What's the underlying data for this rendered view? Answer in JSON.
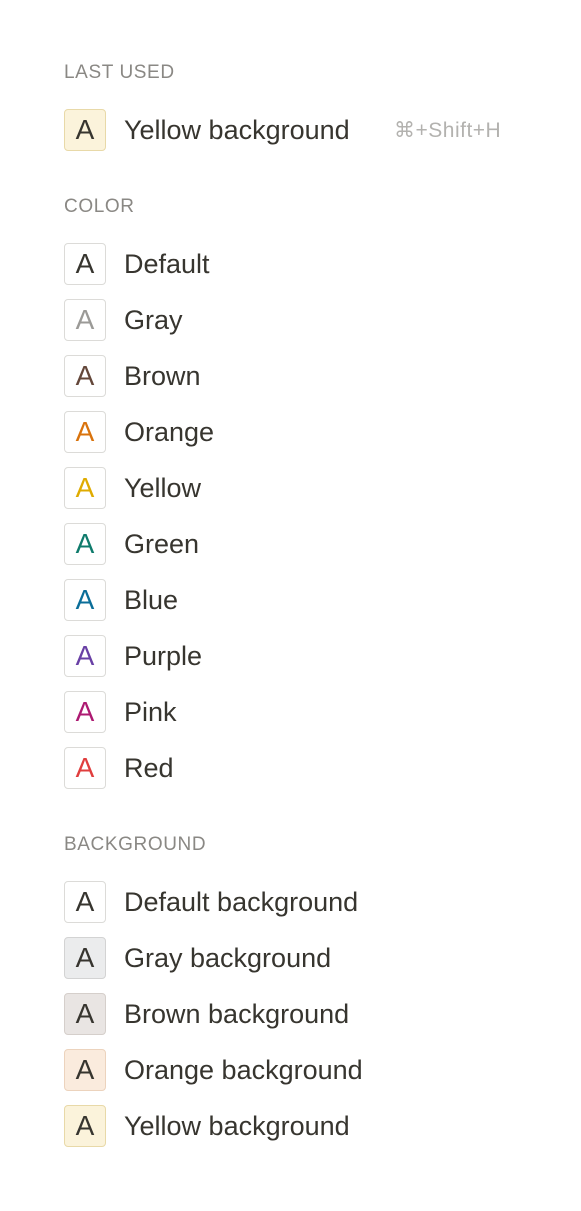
{
  "sections": {
    "last_used": {
      "title": "LAST USED",
      "items": [
        {
          "glyph": "A",
          "label": "Yellow background",
          "shortcut": "⌘+Shift+H",
          "text_color": "#37352f",
          "bg_color": "#fbf3db",
          "border_color": "#e8d9a8"
        }
      ]
    },
    "color": {
      "title": "COLOR",
      "items": [
        {
          "glyph": "A",
          "label": "Default",
          "text_color": "#37352f",
          "bg_color": "#ffffff"
        },
        {
          "glyph": "A",
          "label": "Gray",
          "text_color": "#9b9a97",
          "bg_color": "#ffffff"
        },
        {
          "glyph": "A",
          "label": "Brown",
          "text_color": "#64473a",
          "bg_color": "#ffffff"
        },
        {
          "glyph": "A",
          "label": "Orange",
          "text_color": "#d9730d",
          "bg_color": "#ffffff"
        },
        {
          "glyph": "A",
          "label": "Yellow",
          "text_color": "#dfab01",
          "bg_color": "#ffffff"
        },
        {
          "glyph": "A",
          "label": "Green",
          "text_color": "#0f7b6c",
          "bg_color": "#ffffff"
        },
        {
          "glyph": "A",
          "label": "Blue",
          "text_color": "#0b6e99",
          "bg_color": "#ffffff"
        },
        {
          "glyph": "A",
          "label": "Purple",
          "text_color": "#6940a5",
          "bg_color": "#ffffff"
        },
        {
          "glyph": "A",
          "label": "Pink",
          "text_color": "#ad1a72",
          "bg_color": "#ffffff"
        },
        {
          "glyph": "A",
          "label": "Red",
          "text_color": "#e03e3e",
          "bg_color": "#ffffff"
        }
      ]
    },
    "background": {
      "title": "BACKGROUND",
      "items": [
        {
          "glyph": "A",
          "label": "Default background",
          "text_color": "#37352f",
          "bg_color": "#ffffff",
          "border_color": "#dcdbd8"
        },
        {
          "glyph": "A",
          "label": "Gray background",
          "text_color": "#37352f",
          "bg_color": "#ebeced",
          "border_color": "#d3d3d3"
        },
        {
          "glyph": "A",
          "label": "Brown background",
          "text_color": "#37352f",
          "bg_color": "#e9e5e3",
          "border_color": "#d5cfcb"
        },
        {
          "glyph": "A",
          "label": "Orange background",
          "text_color": "#37352f",
          "bg_color": "#faebdd",
          "border_color": "#ecd3bd"
        },
        {
          "glyph": "A",
          "label": "Yellow background",
          "text_color": "#37352f",
          "bg_color": "#fbf3db",
          "border_color": "#e8d9a8"
        }
      ]
    }
  }
}
